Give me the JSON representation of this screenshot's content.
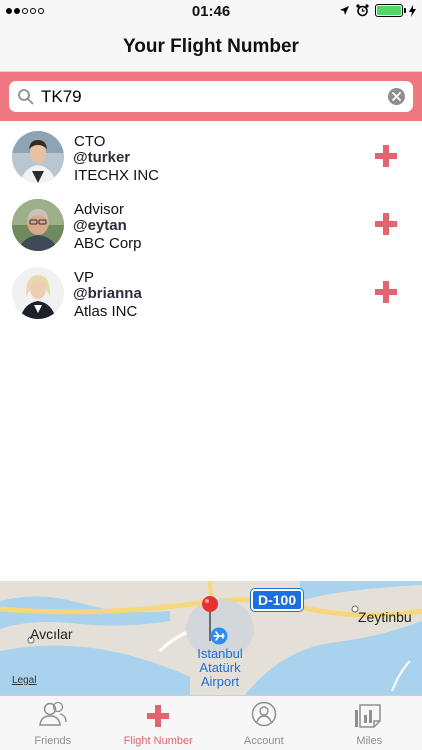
{
  "status_bar": {
    "time": "01:46",
    "signal_filled": 2,
    "signal_total": 5,
    "battery_level": 1.0
  },
  "header": {
    "title": "Your Flight Number"
  },
  "search": {
    "value": "TK79"
  },
  "results": [
    {
      "role": "CTO",
      "handle": "@turker",
      "company": "ITECHX INC"
    },
    {
      "role": "Advisor",
      "handle": "@eytan",
      "company": "ABC Corp"
    },
    {
      "role": "VP",
      "handle": "@brianna",
      "company": "Atlas INC"
    }
  ],
  "map": {
    "labels": {
      "west": "Avcılar",
      "east": "Zeytinbu",
      "road": "D-100",
      "airport_line1": "Istanbul",
      "airport_line2": "Atatürk",
      "airport_line3": "Airport",
      "legal": "Legal"
    }
  },
  "tabs": [
    {
      "label": "Friends",
      "icon": "friends-icon",
      "active": false
    },
    {
      "label": "Flight Number",
      "icon": "plus-icon",
      "active": true
    },
    {
      "label": "Account",
      "icon": "account-icon",
      "active": false
    },
    {
      "label": "Miles",
      "icon": "miles-icon",
      "active": false
    }
  ],
  "colors": {
    "accent": "#e26470",
    "search_band": "#ef7780",
    "battery": "#4cd964",
    "map_water": "#a9d2ee"
  }
}
